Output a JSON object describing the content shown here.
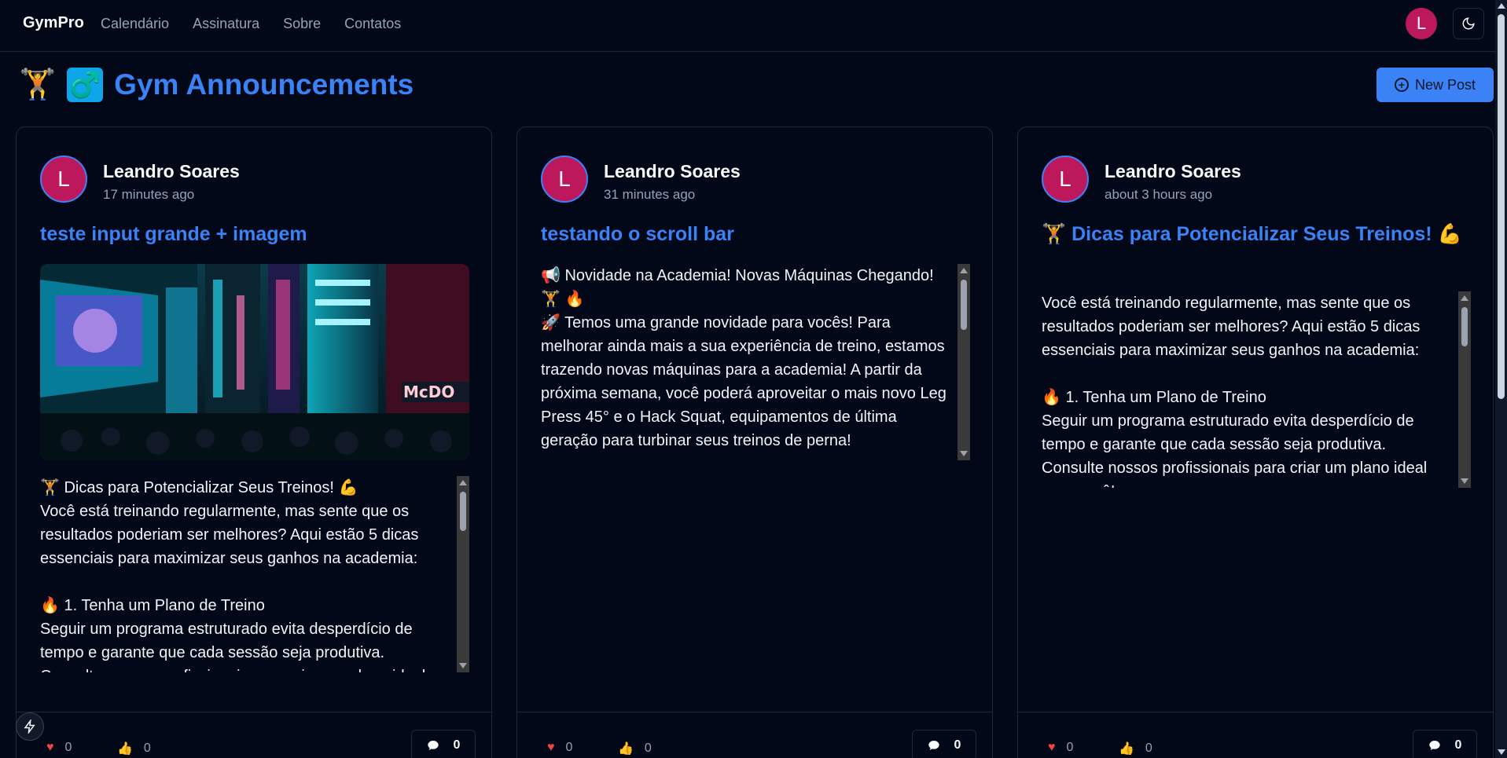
{
  "nav": {
    "brand": "GymPro",
    "links": [
      "Calendário",
      "Assinatura",
      "Sobre",
      "Contatos"
    ],
    "avatar_initial": "L",
    "theme_icon": "moon-icon"
  },
  "header": {
    "emoji1": "🏋️",
    "emoji2": "♂️",
    "title": "Gym Announcements",
    "new_post_label": "New Post"
  },
  "posts": [
    {
      "avatar_initial": "L",
      "author": "Leandro Soares",
      "time": "17 minutes ago",
      "title": "teste input grande + imagem",
      "has_image": true,
      "body": "🏋️ Dicas para Potencializar Seus Treinos! 💪\nVocê está treinando regularmente, mas sente que os resultados poderiam ser melhores? Aqui estão 5 dicas essenciais para maximizar seus ganhos na academia:\n\n🔥 1. Tenha um Plano de Treino\nSeguir um programa estruturado evita desperdício de tempo e garante que cada sessão seja produtiva. Consulte nossos profissionais para criar um plano ideal",
      "hearts": "0",
      "thumbs": "0",
      "comments": "0"
    },
    {
      "avatar_initial": "L",
      "author": "Leandro Soares",
      "time": "31 minutes ago",
      "title": "testando o scroll bar",
      "has_image": false,
      "body": "📢 Novidade na Academia! Novas Máquinas Chegando! 🏋️ 🔥\n🚀 Temos uma grande novidade para vocês! Para melhorar ainda mais a sua experiência de treino, estamos trazendo novas máquinas para a academia! A partir da próxima semana, você poderá aproveitar o mais novo Leg Press 45° e o Hack Squat, equipamentos de última geração para turbinar seus treinos de perna!",
      "hearts": "0",
      "thumbs": "0",
      "comments": "0"
    },
    {
      "avatar_initial": "L",
      "author": "Leandro Soares",
      "time": "about 3 hours ago",
      "title": "🏋️ Dicas para Potencializar Seus Treinos! 💪",
      "has_image": false,
      "body": "Você está treinando regularmente, mas sente que os resultados poderiam ser melhores? Aqui estão 5 dicas essenciais para maximizar seus ganhos na academia:\n\n🔥 1. Tenha um Plano de Treino\nSeguir um programa estruturado evita desperdício de tempo e garante que cada sessão seja produtiva. Consulte nossos profissionais para criar um plano ideal para você!",
      "hearts": "0",
      "thumbs": "0",
      "comments": "0"
    }
  ],
  "colors": {
    "background": "#020817",
    "accent": "#3b82f6",
    "avatar": "#be185d",
    "muted": "#94a3b8"
  }
}
